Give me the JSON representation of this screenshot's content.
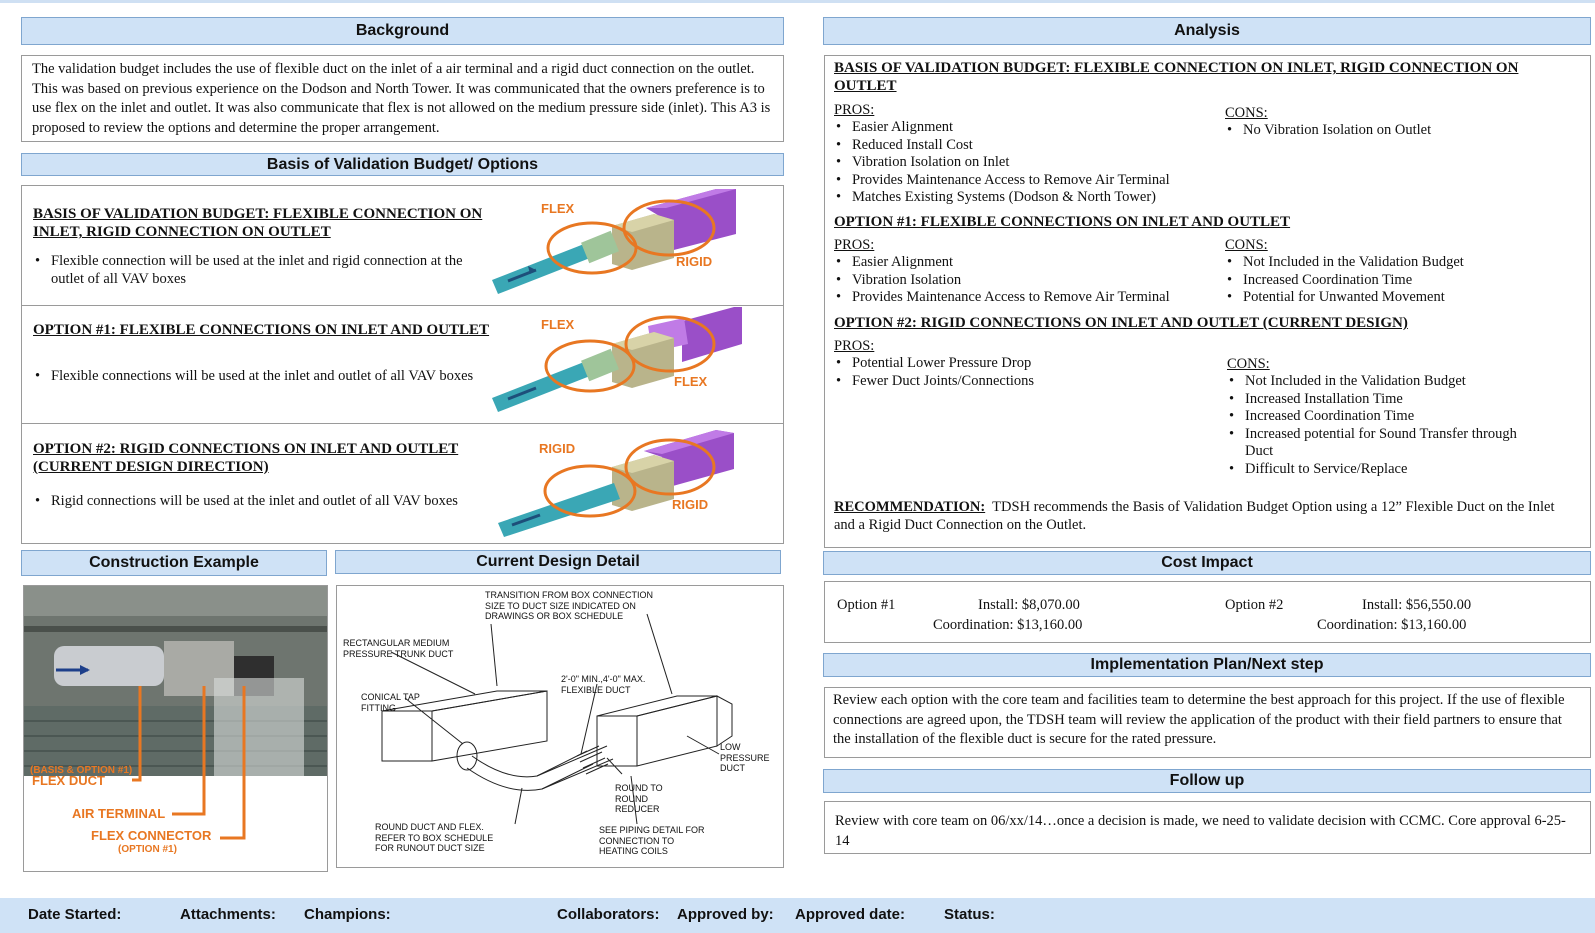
{
  "headers": {
    "background": "Background",
    "basis": "Basis of Validation Budget/ Options",
    "construction": "Construction Example",
    "detail": "Current Design Detail",
    "analysis": "Analysis",
    "cost": "Cost Impact",
    "plan": "Implementation Plan/Next step",
    "followup": "Follow up"
  },
  "background_text": "The validation budget includes the use of flexible duct on the inlet of a air terminal and a rigid duct connection on the outlet.  This was based on previous experience on the Dodson and North Tower. It was communicated that the owners preference is to use flex on the inlet and outlet.  It was also communicate that flex is not allowed on the medium pressure side (inlet).  This A3 is proposed to review the options and determine the proper arrangement.",
  "options": [
    {
      "title": "BASIS OF VALIDATION BUDGET: FLEXIBLE CONNECTION ON INLET, RIGID CONNECTION ON OUTLET",
      "bullet": "Flexible connection will be used at the inlet and rigid connection at the outlet of all VAV boxes",
      "inlet_label": "FLEX",
      "outlet_label": "RIGID"
    },
    {
      "title": "OPTION #1: FLEXIBLE CONNECTIONS ON INLET AND OUTLET",
      "bullet": "Flexible connections will be used at the inlet and outlet of all VAV boxes",
      "inlet_label": "FLEX",
      "outlet_label": "FLEX"
    },
    {
      "title": "OPTION #2: RIGID CONNECTIONS ON INLET AND OUTLET (CURRENT DESIGN DIRECTION)",
      "bullet": "Rigid connections will be used at the inlet and outlet of all VAV boxes",
      "inlet_label": "RIGID",
      "outlet_label": "RIGID"
    }
  ],
  "construction": {
    "overlay": "(BASIS & OPTION #1)",
    "flex_duct": "FLEX DUCT",
    "air_terminal": "AIR TERMINAL",
    "flex_connector": "FLEX CONNECTOR",
    "flex_connector_sub": "(OPTION #1)"
  },
  "detail_labels": {
    "transition": "TRANSITION FROM BOX CONNECTION SIZE TO DUCT SIZE INDICATED ON DRAWINGS OR BOX SCHEDULE",
    "trunk": "RECTANGULAR MEDIUM PRESSURE TRUNK DUCT",
    "conical": "CONICAL TAP FITTING",
    "flex": "2'-0\" MIN.,4'-0\" MAX. FLEXIBLE DUCT",
    "low": "LOW PRESSURE DUCT",
    "reducer": "ROUND TO ROUND REDUCER",
    "round": "ROUND DUCT AND FLEX. REFER TO BOX SCHEDULE FOR RUNOUT DUCT SIZE",
    "piping": "SEE PIPING DETAIL FOR CONNECTION TO HEATING COILS"
  },
  "analysis": {
    "pros_label": "PROS:",
    "cons_label": "CONS:",
    "sections": [
      {
        "title": "BASIS OF VALIDATION BUDGET: FLEXIBLE CONNECTION ON INLET, RIGID CONNECTION ON OUTLET",
        "pros": [
          "Easier Alignment",
          "Reduced Install Cost",
          "Vibration Isolation on Inlet",
          "Provides Maintenance Access to Remove Air Terminal",
          "Matches Existing Systems (Dodson & North Tower)"
        ],
        "cons": [
          "No Vibration Isolation on Outlet"
        ]
      },
      {
        "title": "OPTION #1: FLEXIBLE CONNECTIONS ON INLET AND OUTLET",
        "pros": [
          "Easier Alignment",
          "Vibration Isolation",
          "Provides Maintenance Access to Remove Air Terminal"
        ],
        "cons": [
          "Not Included in the Validation Budget",
          "Increased Coordination Time",
          "Potential for Unwanted Movement"
        ]
      },
      {
        "title": "OPTION #2: RIGID CONNECTIONS ON INLET AND OUTLET (CURRENT DESIGN)",
        "pros": [
          "Potential Lower Pressure Drop",
          "Fewer Duct Joints/Connections"
        ],
        "cons": [
          "Not Included in the Validation Budget",
          "Increased Installation Time",
          "Increased Coordination Time",
          "Increased potential for Sound Transfer through Duct",
          "Difficult to Service/Replace"
        ]
      }
    ],
    "recommendation_label": "RECOMMENDATION:",
    "recommendation_text": "TDSH recommends the Basis of Validation Budget Option using a 12” Flexible Duct on the Inlet and a Rigid Duct Connection on the Outlet."
  },
  "cost": {
    "opt1_label": "Option #1",
    "opt1_install": "Install:  $8,070.00",
    "opt1_coord": "Coordination: $13,160.00",
    "opt2_label": "Option #2",
    "opt2_install": "Install:  $56,550.00",
    "opt2_coord": "Coordination:  $13,160.00"
  },
  "plan_text": "Review each option with the core team and facilities team to determine the best approach for this project.  If the use of flexible connections are agreed upon, the TDSH team will review the application of the product with their field partners to ensure that the installation of the flexible duct is secure for the rated pressure.",
  "followup_text": "Review with core team on 06/xx/14…once a decision is made, we need to validate decision with CCMC. Core approval 6-25-14",
  "footer": {
    "date_started": "Date Started:",
    "attachments": "Attachments:",
    "champions": "Champions:",
    "collaborators": "Collaborators:",
    "approved_by": "Approved by:",
    "approved_date": "Approved  date:",
    "status": "Status:"
  },
  "colors": {
    "header_bg": "#cfe2f6",
    "accent_orange": "#e87722",
    "duct_teal": "#3aa7b5",
    "duct_purple": "#9a4fc8"
  }
}
